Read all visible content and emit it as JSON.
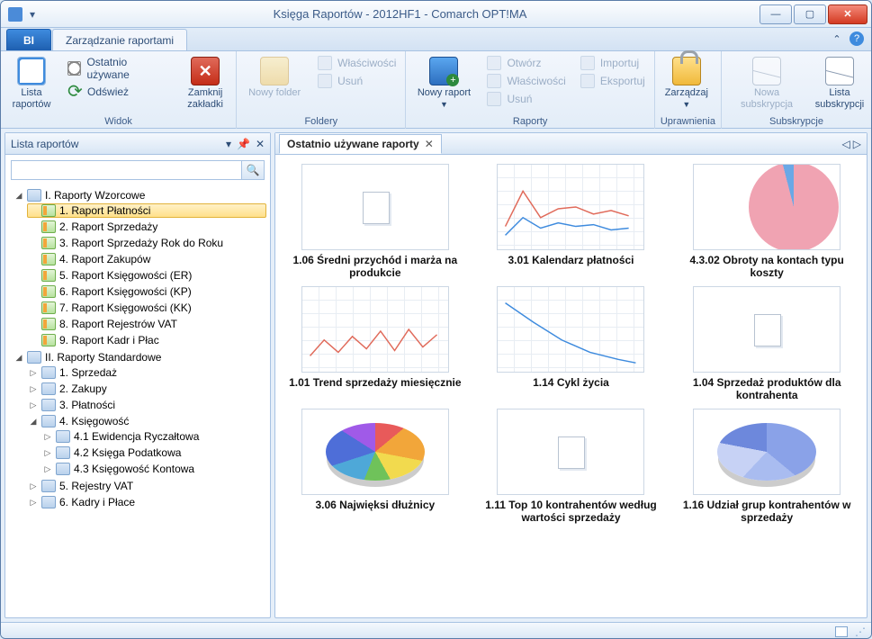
{
  "title": "Księga Raportów - 2012HF1 - Comarch OPT!MA",
  "tabs": {
    "bi": "BI",
    "manage": "Zarządzanie raportami"
  },
  "ribbon": {
    "view": {
      "label": "Widok",
      "lista_raportow": "Lista raportów",
      "ostatnio_uzywane": "Ostatnio używane",
      "odswiez": "Odśwież",
      "zamknij_zakladki": "Zamknij zakładki"
    },
    "folders": {
      "label": "Foldery",
      "nowy_folder": "Nowy folder",
      "wlasciwosci": "Właściwości",
      "usun": "Usuń"
    },
    "reports": {
      "label": "Raporty",
      "nowy_raport": "Nowy raport",
      "otworz": "Otwórz",
      "wlasciwosci": "Właściwości",
      "usun": "Usuń",
      "importuj": "Importuj",
      "eksportuj": "Eksportuj"
    },
    "permissions": {
      "label": "Uprawnienia",
      "zarzadzaj": "Zarządzaj"
    },
    "subscriptions": {
      "label": "Subskrypcje",
      "nowa_sub": "Nowa subskrypcja",
      "lista_sub": "Lista subskrypcji"
    }
  },
  "panel": {
    "title": "Lista raportów",
    "search_placeholder": ""
  },
  "tree": {
    "r1": {
      "title": "I. Raporty Wzorcowe",
      "items": [
        "1. Raport Płatności",
        "2. Raport Sprzedaży",
        "3. Raport Sprzedaży Rok do Roku",
        "4. Raport Zakupów",
        "5. Raport Księgowości (ER)",
        "6. Raport Księgowości (KP)",
        "7. Raport Księgowości (KK)",
        "8. Raport Rejestrów VAT",
        "9. Raport Kadr i Płac"
      ]
    },
    "r2": {
      "title": "II. Raporty Standardowe",
      "items": [
        "1. Sprzedaż",
        "2. Zakupy",
        "3. Płatności"
      ],
      "ksieg": "4. Księgowość",
      "ksieg_children": [
        "4.1 Ewidencja Ryczałtowa",
        "4.2 Księga Podatkowa",
        "4.3 Księgowość Kontowa"
      ],
      "rest": [
        "5. Rejestry VAT",
        "6. Kadry i Płace"
      ]
    }
  },
  "doc": {
    "tab": "Ostatnio używane raporty",
    "cards": [
      "1.06 Średni przychód i marża na produkcie",
      "3.01 Kalendarz płatności",
      "4.3.02 Obroty na kontach typu koszty",
      "1.01 Trend sprzedaży miesięcznie",
      "1.14 Cykl życia",
      "1.04 Sprzedaż produktów dla kontrahenta",
      "3.06 Najwięksi dłużnicy",
      "1.11 Top 10 kontrahentów według wartości sprzedaży",
      "1.16 Udział grup kontrahentów w sprzedaży"
    ]
  }
}
